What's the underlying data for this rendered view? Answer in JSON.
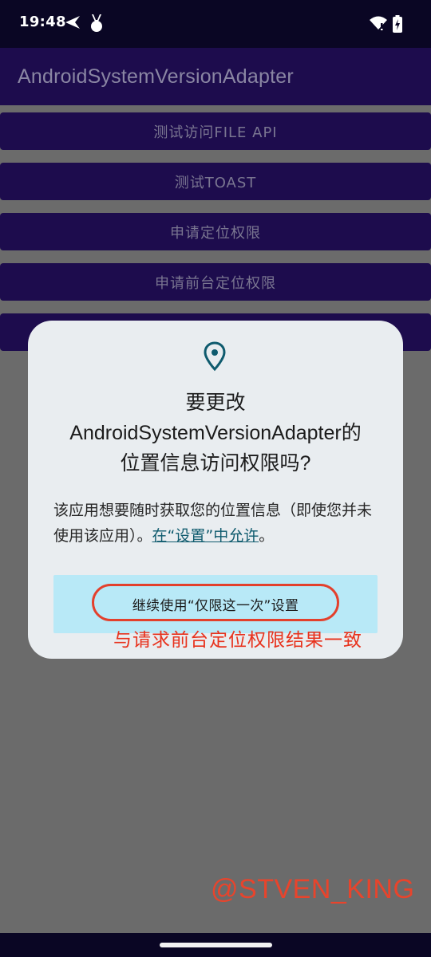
{
  "status_bar": {
    "time": "19:48",
    "icons_left": [
      "navigation-arrow-icon",
      "bunny-icon"
    ],
    "icons_right": [
      "wifi-icon",
      "battery-icon"
    ]
  },
  "app_bar": {
    "title": "AndroidSystemVersionAdapter"
  },
  "buttons": [
    {
      "label": "测试访问FILE API"
    },
    {
      "label": "测试TOAST"
    },
    {
      "label": "申请定位权限"
    },
    {
      "label": "申请前台定位权限"
    }
  ],
  "dialog": {
    "icon": "location-pin-icon",
    "title_line1": "要更改",
    "title_line2": "AndroidSystemVersionAdapter的",
    "title_line3": "位置信息访问权限吗?",
    "body_text": "该应用想要随时获取您的位置信息（即使您并未使用该应用）。",
    "settings_link": "在“设置”中允许",
    "body_end": "。",
    "option_label": "继续使用“仅限这一次”设置"
  },
  "annotation": {
    "text": "与请求前台定位权限结果一致"
  },
  "watermark": "@STVEN_KING",
  "colors": {
    "primary_dark": "#1d0c4d",
    "dialog_bg": "#e9edf0",
    "option_bg": "#b8e9f7",
    "accent_teal": "#0f5b6e",
    "annotation_red": "#e3402c",
    "scrim": "#6b6b6b"
  }
}
